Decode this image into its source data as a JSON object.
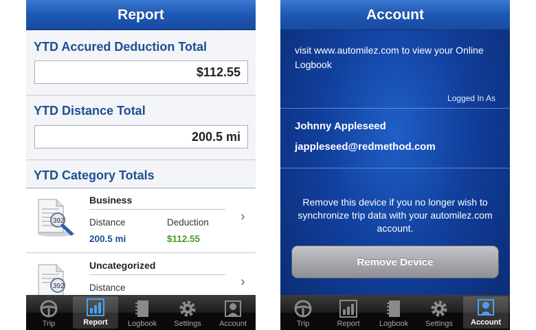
{
  "report": {
    "title": "Report",
    "sections": {
      "accrued_label": "YTD Accured Deduction Total",
      "accrued_value": "$112.55",
      "distance_label": "YTD Distance Total",
      "distance_value": "200.5 mi",
      "category_label": "YTD Category Totals"
    },
    "categories": [
      {
        "name": "Business",
        "distance_label": "Distance",
        "deduction_label": "Deduction",
        "distance": "200.5 mi",
        "deduction": "$112.55"
      },
      {
        "name": "Uncategorized",
        "distance_label": "Distance"
      }
    ],
    "colors": {
      "heading_blue": "#1c4f95",
      "deduction_green": "#4a9a2a"
    }
  },
  "account": {
    "title": "Account",
    "visit_text": "visit www.automilez.com to view your Online Logbook",
    "logged_in_label": "Logged In As",
    "user_name": "Johnny Appleseed",
    "user_email": "jappleseed@redmethod.com",
    "remove_note": "Remove this device if you no longer wish to synchronize trip data with your automilez.com account.",
    "remove_button": "Remove Device"
  },
  "tabs": [
    {
      "label": "Trip",
      "icon": "steering-wheel-icon"
    },
    {
      "label": "Report",
      "icon": "bar-chart-icon"
    },
    {
      "label": "Logbook",
      "icon": "logbook-icon"
    },
    {
      "label": "Settings",
      "icon": "gear-icon"
    },
    {
      "label": "Account",
      "icon": "person-icon"
    }
  ],
  "icons": {
    "category": "document-magnifier-icon",
    "chevron": "chevron-right-icon"
  }
}
